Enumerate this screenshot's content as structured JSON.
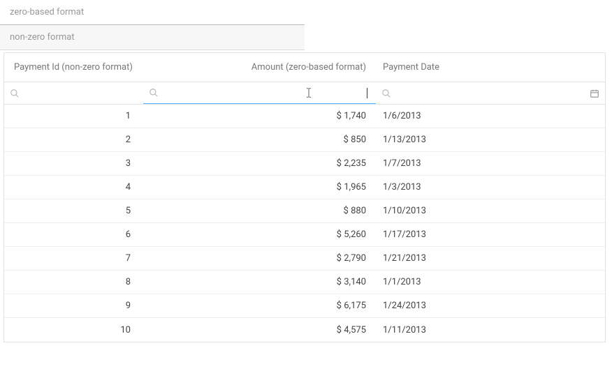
{
  "tabs": {
    "zero": "zero-based format",
    "nonzero": "non-zero format"
  },
  "headers": {
    "payment_id": "Payment Id (non-zero format)",
    "amount": "Amount (zero-based format)",
    "payment_date": "Payment Date"
  },
  "filters": {
    "payment_id_value": "",
    "amount_value": "",
    "payment_date_value": ""
  },
  "rows": [
    {
      "id": "1",
      "amount": "$ 1,740",
      "date": "1/6/2013"
    },
    {
      "id": "2",
      "amount": "$ 850",
      "date": "1/13/2013"
    },
    {
      "id": "3",
      "amount": "$ 2,235",
      "date": "1/7/2013"
    },
    {
      "id": "4",
      "amount": "$ 1,965",
      "date": "1/3/2013"
    },
    {
      "id": "5",
      "amount": "$ 880",
      "date": "1/10/2013"
    },
    {
      "id": "6",
      "amount": "$ 5,260",
      "date": "1/17/2013"
    },
    {
      "id": "7",
      "amount": "$ 2,790",
      "date": "1/21/2013"
    },
    {
      "id": "8",
      "amount": "$ 3,140",
      "date": "1/1/2013"
    },
    {
      "id": "9",
      "amount": "$ 6,175",
      "date": "1/24/2013"
    },
    {
      "id": "10",
      "amount": "$ 4,575",
      "date": "1/11/2013"
    }
  ]
}
